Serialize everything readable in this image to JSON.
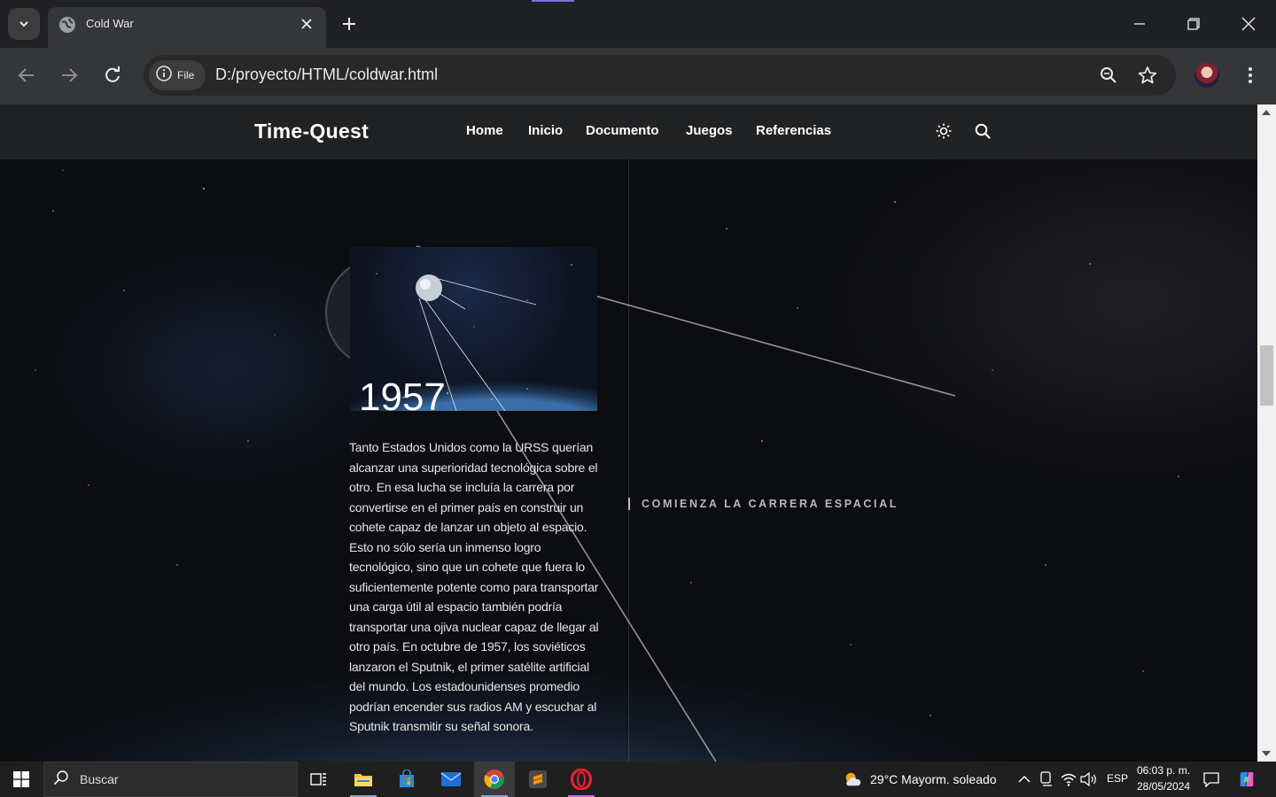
{
  "browser": {
    "tab_title": "Cold War",
    "site_chip": "File",
    "url": "D:/proyecto/HTML/coldwar.html"
  },
  "page": {
    "brand": "Time-Quest",
    "nav": [
      "Home",
      "Inicio",
      "Documento",
      "Juegos",
      "Referencias"
    ],
    "event": {
      "year": "1957",
      "heading": "COMIENZA LA CARRERA ESPACIAL",
      "text": "Tanto Estados Unidos como la URSS querían alcanzar una superioridad tecnológica sobre el otro. En esa lucha se incluía la carrera por convertirse en el primer país en construir un cohete capaz de lanzar un objeto al espacio. Esto no sólo sería un inmenso logro tecnológico, sino que un cohete que fuera lo suficientemente potente como para transportar una carga útil al espacio también podría transportar una ojiva nuclear capaz de llegar al otro país. En octubre de 1957, los soviéticos lanzaron el Sputnik, el primer satélite artificial del mundo. Los estadounidenses promedio podrían encender sus radios AM y escuchar al Sputnik transmitir su señal sonora."
    }
  },
  "taskbar": {
    "search_label": "Buscar",
    "weather": "29°C  Mayorm. soleado",
    "language": "ESP",
    "time": "06:03 p. m.",
    "date": "28/05/2024"
  },
  "icons": {
    "browser": [
      "tab-search-icon",
      "globe-icon",
      "close-icon",
      "plus-icon",
      "minimize-icon",
      "restore-icon",
      "window-close-icon",
      "back-icon",
      "forward-icon",
      "reload-icon",
      "info-icon",
      "zoom-icon",
      "star-icon",
      "more-icon"
    ],
    "page": [
      "sun-icon",
      "search-icon"
    ],
    "taskbar": [
      "windows-icon",
      "search-icon",
      "task-view-icon",
      "file-explorer-icon",
      "store-icon",
      "mail-icon",
      "chrome-icon",
      "sublime-icon",
      "opera-icon",
      "weather-icon",
      "chevron-up-icon",
      "meet-icon",
      "wifi-icon",
      "volume-icon",
      "notifications-icon",
      "copilot-icon"
    ]
  },
  "colors": {
    "chrome_dark": "#202124",
    "toolbar": "#35363a",
    "site_header": "#212224",
    "taskbar": "#1f1f1f"
  },
  "scroll_position": 0.4
}
